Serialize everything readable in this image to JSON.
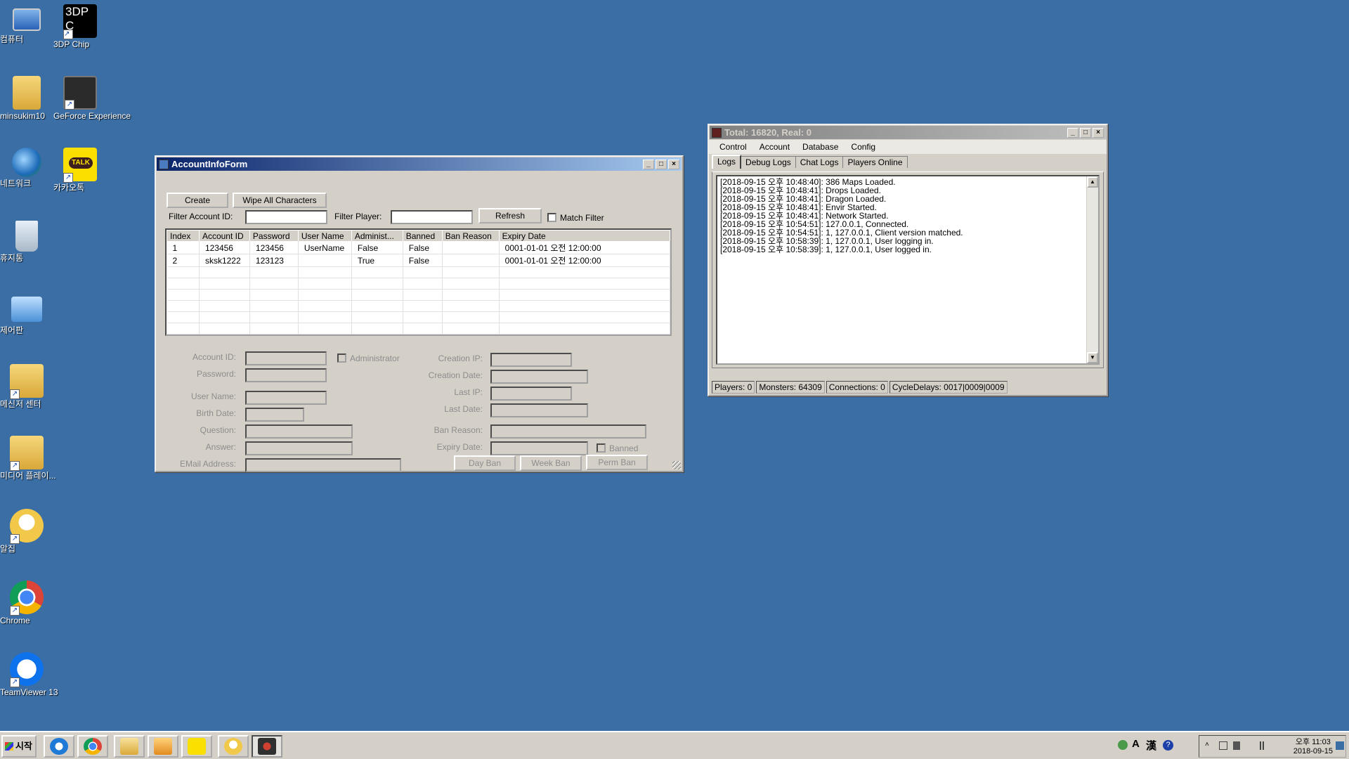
{
  "desktop": {
    "icons": [
      {
        "label": "컴퓨터"
      },
      {
        "label": "3DP Chip"
      },
      {
        "label": "minsukim10"
      },
      {
        "label": "GeForce Experience"
      },
      {
        "label": "네트워크"
      },
      {
        "label": "카카오톡"
      },
      {
        "label": "휴지통"
      },
      {
        "label": "제어판"
      },
      {
        "label": "메신저 센터"
      },
      {
        "label": "미디어 플레이..."
      },
      {
        "label": "알집"
      },
      {
        "label": "Chrome"
      },
      {
        "label": "TeamViewer 13"
      }
    ],
    "chip_logo_text": "3DP C",
    "talk_logo_text": "TALK"
  },
  "account_form": {
    "title": "AccountInfoForm",
    "create_button": "Create",
    "wipe_button": "Wipe All Characters",
    "filter_account_label": "Filter Account ID:",
    "filter_account_value": "",
    "filter_player_label": "Filter Player:",
    "filter_player_value": "",
    "refresh_button": "Refresh",
    "match_filter_label": "Match Filter",
    "columns": [
      "Index",
      "Account ID",
      "Password",
      "User Name",
      "Administ...",
      "Banned",
      "Ban Reason",
      "Expiry Date"
    ],
    "rows": [
      [
        "1",
        "123456",
        "123456",
        "UserName",
        "False",
        "False",
        "",
        "0001-01-01 오전 12:00:00"
      ],
      [
        "2",
        "sksk1222",
        "123123",
        "",
        "True",
        "False",
        "",
        "0001-01-01 오전 12:00:00"
      ]
    ],
    "details": {
      "account_id_label": "Account ID:",
      "administrator_label": "Administrator",
      "password_label": "Password:",
      "user_name_label": "User Name:",
      "birth_date_label": "Birth Date:",
      "question_label": "Question:",
      "answer_label": "Answer:",
      "email_label": "EMail Address:",
      "creation_ip_label": "Creation IP:",
      "creation_date_label": "Creation Date:",
      "last_ip_label": "Last IP:",
      "last_date_label": "Last Date:",
      "ban_reason_label": "Ban Reason:",
      "expiry_date_label": "Expiry Date:",
      "banned_label": "Banned",
      "day_ban_button": "Day Ban",
      "week_ban_button": "Week Ban",
      "perm_ban_button": "Perm Ban"
    }
  },
  "server_window": {
    "title": "Total: 16820, Real: 0",
    "menu": [
      "Control",
      "Account",
      "Database",
      "Config"
    ],
    "tabs": [
      "Logs",
      "Debug Logs",
      "Chat Logs",
      "Players Online"
    ],
    "selected_tab": "Logs",
    "logs": [
      "[2018-09-15 오후 10:48:40]: 386 Maps Loaded.",
      "[2018-09-15 오후 10:48:41]: Drops Loaded.",
      "[2018-09-15 오후 10:48:41]: Dragon Loaded.",
      "[2018-09-15 오후 10:48:41]: Envir Started.",
      "[2018-09-15 오후 10:48:41]: Network Started.",
      "[2018-09-15 오후 10:54:51]: 127.0.0.1, Connected.",
      "[2018-09-15 오후 10:54:51]: 1, 127.0.0.1, Client version matched.",
      "[2018-09-15 오후 10:58:39]: 1, 127.0.0.1, User logging in.",
      "[2018-09-15 오후 10:58:39]: 1, 127.0.0.1, User logged in."
    ],
    "status": {
      "players": "Players: 0",
      "monsters": "Monsters: 64309",
      "connections": "Connections: 0",
      "cycle_delays": "CycleDelays: 0017|0009|0009"
    }
  },
  "taskbar": {
    "start_label": "시작",
    "clock_time": "오후 11:03",
    "clock_date": "2018-09-15",
    "ime_mode": "A",
    "ime_hanja": "漢"
  }
}
